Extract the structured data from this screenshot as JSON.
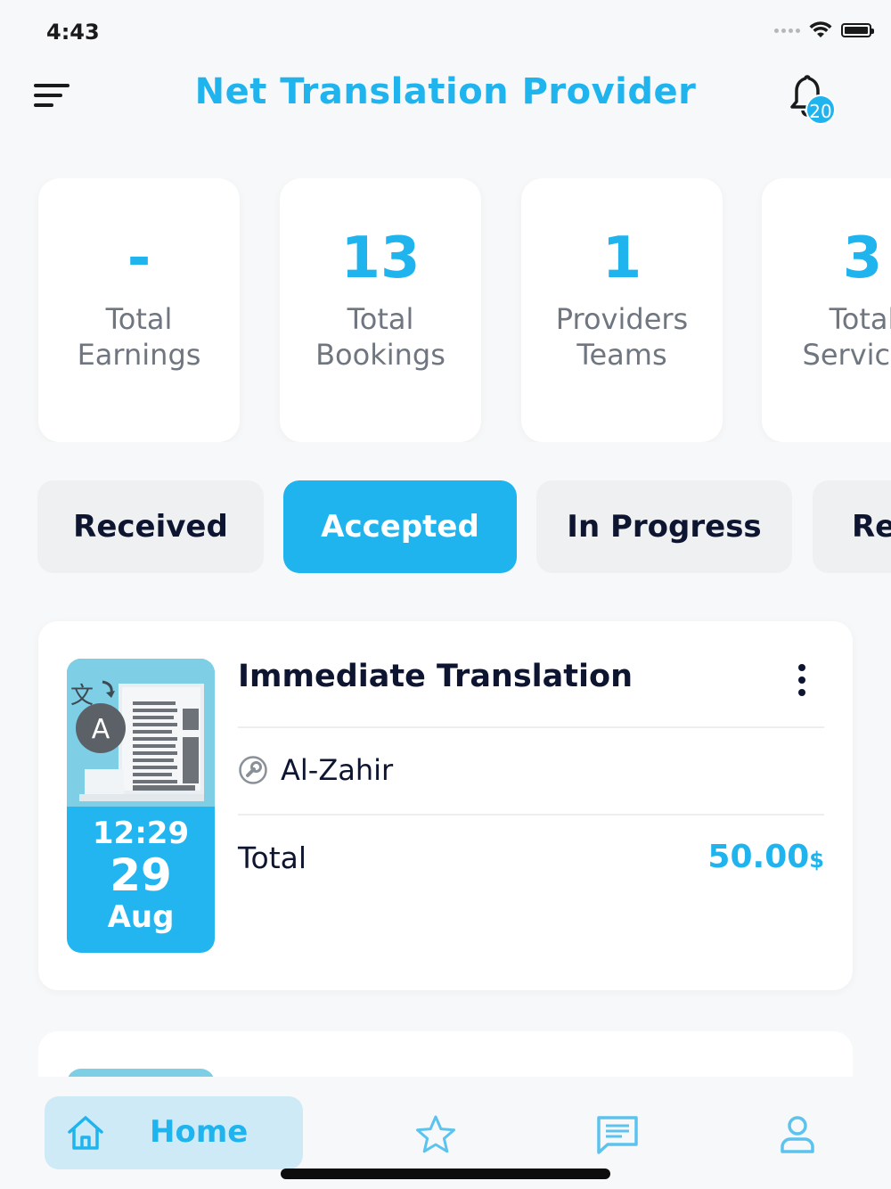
{
  "status_bar": {
    "time": "4:43"
  },
  "header": {
    "title": "Net Translation Provider",
    "notification_count": "20"
  },
  "stats": [
    {
      "value": "-",
      "label": "Total\nEarnings"
    },
    {
      "value": "13",
      "label": "Total\nBookings"
    },
    {
      "value": "1",
      "label": "Providers\nTeams"
    },
    {
      "value": "3",
      "label": "Total\nServices"
    }
  ],
  "tabs": [
    {
      "label": "Received",
      "active": false
    },
    {
      "label": "Accepted",
      "active": true
    },
    {
      "label": "In Progress",
      "active": false
    },
    {
      "label": "Re",
      "active": false
    }
  ],
  "booking": {
    "title": "Immediate Translation",
    "provider": "Al-Zahir",
    "total_label": "Total",
    "total_value": "50.00",
    "currency": "$",
    "time": "12:29",
    "day": "29",
    "month": "Aug",
    "thumb_letter": "A"
  },
  "nav": {
    "home_label": "Home"
  },
  "colors": {
    "accent": "#1fb4ee",
    "dark": "#0d1530",
    "muted": "#6f7680"
  }
}
